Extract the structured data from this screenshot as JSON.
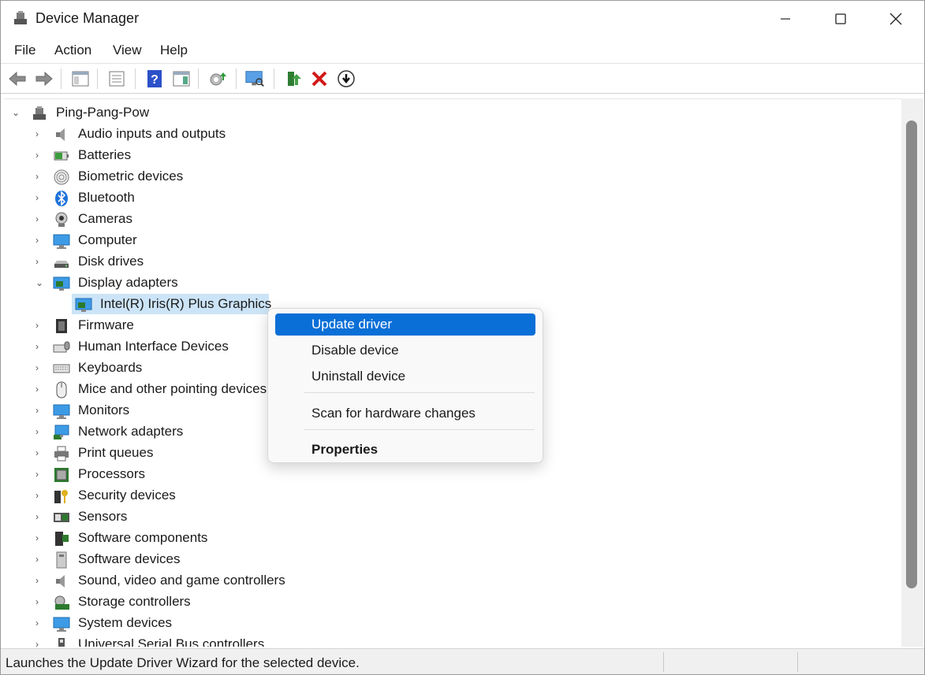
{
  "window": {
    "title": "Device Manager"
  },
  "menu": [
    "File",
    "Action",
    "View",
    "Help"
  ],
  "toolbar": [
    "back-arrow-icon",
    "forward-arrow-icon",
    "show-hide-console-tree-icon",
    "properties-icon",
    "help-icon",
    "action-pane-icon",
    "update-driver-icon",
    "scan-hardware-icon",
    "enable-device-icon",
    "uninstall-icon",
    "disable-device-icon"
  ],
  "tree": {
    "root": "Ping-Pang-Pow",
    "categories": [
      "Audio inputs and outputs",
      "Batteries",
      "Biometric devices",
      "Bluetooth",
      "Cameras",
      "Computer",
      "Disk drives",
      "Display adapters",
      "Intel(R) Iris(R) Plus Graphics",
      "Firmware",
      "Human Interface Devices",
      "Keyboards",
      "Mice and other pointing devices",
      "Monitors",
      "Network adapters",
      "Print queues",
      "Processors",
      "Security devices",
      "Sensors",
      "Software components",
      "Software devices",
      "Sound, video and game controllers",
      "Storage controllers",
      "System devices",
      "Universal Serial Bus controllers"
    ]
  },
  "context_menu": {
    "update": "Update driver",
    "disable": "Disable device",
    "uninstall": "Uninstall device",
    "scan": "Scan for hardware changes",
    "properties": "Properties"
  },
  "status": "Launches the Update Driver Wizard for the selected device.",
  "colors": {
    "selection": "#cce4f7",
    "menu_highlight": "#0a6fd6"
  }
}
